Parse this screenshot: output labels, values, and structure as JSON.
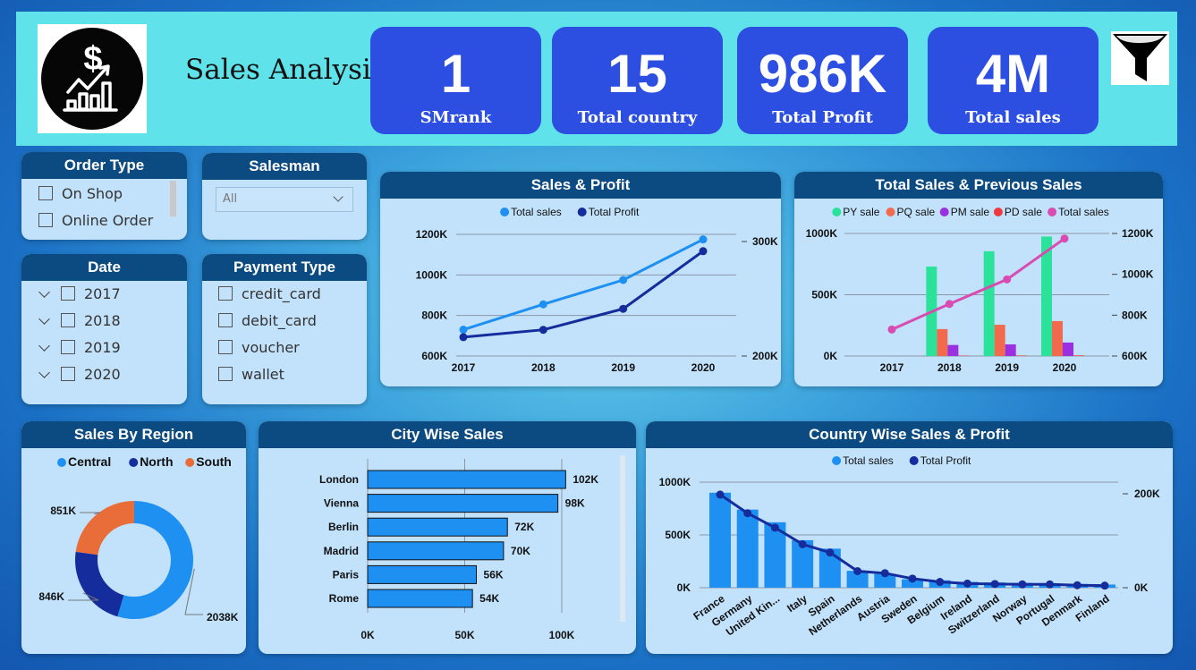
{
  "header": {
    "title": "Sales Analysis",
    "kpis": [
      {
        "value": "1",
        "label": "SMrank"
      },
      {
        "value": "15",
        "label": "Total country"
      },
      {
        "value": "986K",
        "label": "Total Profit"
      },
      {
        "value": "4M",
        "label": "Total sales"
      }
    ],
    "logo_icon": "sales-growth-icon",
    "filter_icon": "funnel-icon"
  },
  "slicers": {
    "order_type": {
      "title": "Order Type",
      "items": [
        "On Shop",
        "Online Order"
      ]
    },
    "salesman": {
      "title": "Salesman",
      "selected": "All"
    },
    "date": {
      "title": "Date",
      "items": [
        "2017",
        "2018",
        "2019",
        "2020"
      ]
    },
    "payment_type": {
      "title": "Payment Type",
      "items": [
        "credit_card",
        "debit_card",
        "voucher",
        "wallet"
      ]
    }
  },
  "colors": {
    "total_sales": "#1e90f2",
    "total_profit": "#152d9c",
    "py": "#2be29a",
    "pq": "#f26a4d",
    "pm": "#9b30e0",
    "pd": "#f0383f",
    "ts_pink": "#d84cb2",
    "central": "#1e90f2",
    "north": "#152d9c",
    "south": "#e86d38"
  },
  "chart_data": [
    {
      "id": "sales-profit",
      "type": "line",
      "title": "Sales & Profit",
      "categories": [
        "2017",
        "2018",
        "2019",
        "2020"
      ],
      "series": [
        {
          "name": "Total sales",
          "axis": "left",
          "values": [
            730,
            855,
            975,
            1175
          ]
        },
        {
          "name": "Total Profit",
          "axis": "right",
          "values": [
            218,
            225,
            245,
            300
          ]
        }
      ],
      "y_left": {
        "range": [
          600,
          1200
        ],
        "ticks": [
          "600K",
          "800K",
          "1000K",
          "1200K"
        ]
      },
      "y_right": {
        "range": [
          200,
          300
        ],
        "ticks": [
          "200K",
          "300K"
        ]
      },
      "legend": "top-center"
    },
    {
      "id": "total-previous-sales",
      "type": "bar",
      "title": "Total Sales & Previous Sales",
      "categories": [
        "2017",
        "2018",
        "2019",
        "2020"
      ],
      "series": [
        {
          "name": "PY sale",
          "axis": "left",
          "values": [
            0,
            730,
            855,
            975
          ]
        },
        {
          "name": "PQ sale",
          "axis": "left",
          "values": [
            0,
            220,
            255,
            285
          ]
        },
        {
          "name": "PM sale",
          "axis": "left",
          "values": [
            0,
            90,
            95,
            110
          ]
        },
        {
          "name": "PD sale",
          "axis": "left",
          "values": [
            0,
            3,
            4,
            5
          ]
        },
        {
          "name": "Total sales",
          "axis": "right",
          "type": "line",
          "values": [
            730,
            855,
            975,
            1175
          ]
        }
      ],
      "y_left": {
        "range": [
          0,
          1000
        ],
        "ticks": [
          "0K",
          "500K",
          "1000K"
        ]
      },
      "y_right": {
        "range": [
          600,
          1200
        ],
        "ticks": [
          "600K",
          "800K",
          "1000K",
          "1200K"
        ]
      },
      "legend": "top-center"
    },
    {
      "id": "sales-by-region",
      "type": "pie",
      "title": "Sales By Region",
      "categories": [
        "Central",
        "North",
        "South"
      ],
      "values": [
        2038,
        846,
        851
      ],
      "labels": [
        "2038K",
        "846K",
        "851K"
      ],
      "legend": "top-left"
    },
    {
      "id": "city-wise-sales",
      "type": "bar",
      "orientation": "horizontal",
      "title": "City Wise Sales",
      "categories": [
        "London",
        "Vienna",
        "Berlin",
        "Madrid",
        "Paris",
        "Rome"
      ],
      "values": [
        102,
        98,
        72,
        70,
        56,
        54
      ],
      "labels": [
        "102K",
        "98K",
        "72K",
        "70K",
        "56K",
        "54K"
      ],
      "x_axis": {
        "range": [
          0,
          100
        ],
        "ticks": [
          "0K",
          "50K",
          "100K"
        ]
      }
    },
    {
      "id": "country-wise-sales-profit",
      "type": "bar",
      "title": "Country Wise Sales & Profit",
      "categories": [
        "France",
        "Germany",
        "United Kin...",
        "Italy",
        "Spain",
        "Netherlands",
        "Austria",
        "Sweden",
        "Belgium",
        "Ireland",
        "Switzerland",
        "Norway",
        "Portugal",
        "Denmark",
        "Finland"
      ],
      "series": [
        {
          "name": "Total sales",
          "axis": "left",
          "values": [
            900,
            740,
            620,
            450,
            370,
            160,
            130,
            80,
            70,
            55,
            50,
            45,
            40,
            35,
            30
          ]
        },
        {
          "name": "Total Profit",
          "axis": "right",
          "type": "line",
          "values": [
            225,
            180,
            145,
            105,
            85,
            40,
            35,
            22,
            14,
            10,
            9,
            8,
            8,
            6,
            5
          ]
        }
      ],
      "y_left": {
        "range": [
          0,
          1000
        ],
        "ticks": [
          "0K",
          "500K",
          "1000K"
        ]
      },
      "y_right": {
        "range": [
          0,
          200
        ],
        "ticks": [
          "0K",
          "200K"
        ]
      },
      "legend": "top-center"
    }
  ]
}
